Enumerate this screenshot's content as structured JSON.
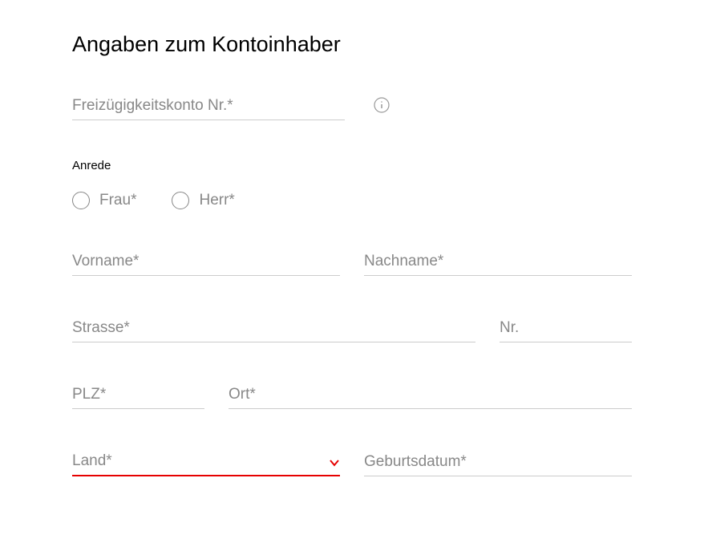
{
  "section_title": "Angaben zum Kontoinhaber",
  "account_field": {
    "placeholder": "Freizügigkeitskonto Nr.*"
  },
  "anrede": {
    "label": "Anrede",
    "options": {
      "frau": "Frau*",
      "herr": "Herr*"
    }
  },
  "vorname_placeholder": "Vorname*",
  "nachname_placeholder": "Nachname*",
  "strasse_placeholder": "Strasse*",
  "nr_placeholder": "Nr.",
  "plz_placeholder": "PLZ*",
  "ort_placeholder": "Ort*",
  "land_placeholder": "Land*",
  "geburtsdatum_placeholder": "Geburtsdatum*",
  "colors": {
    "error_red": "#e60000",
    "placeholder_gray": "#888"
  }
}
